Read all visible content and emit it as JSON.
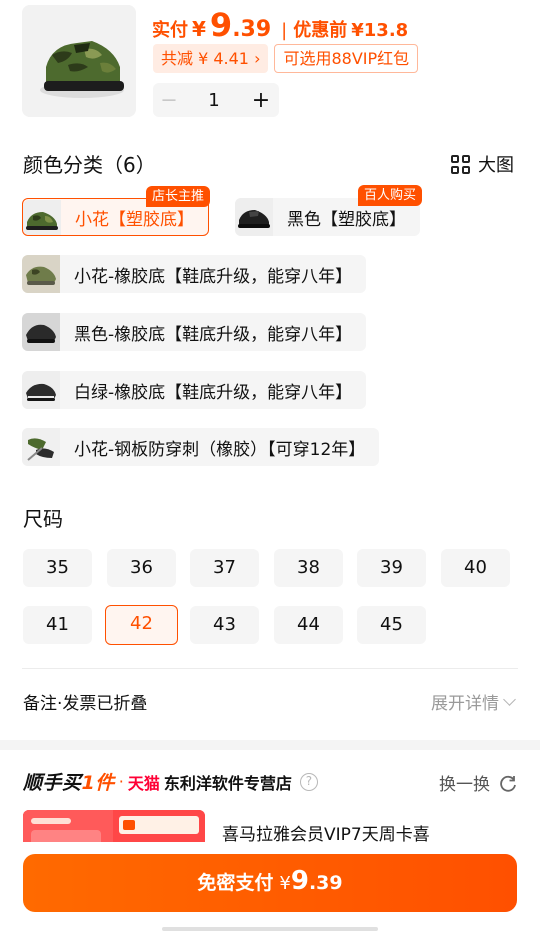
{
  "product": {
    "price_label": "实付",
    "currency": "¥",
    "price_int": "9",
    "price_dec": ".39",
    "orig_label": "优惠前",
    "orig_value": "13.8"
  },
  "promos": [
    {
      "text": "共减 ¥ 4.41 ›"
    },
    {
      "text": "可选用88VIP红包"
    }
  ],
  "stepper": {
    "minus": "－",
    "quantity": "1",
    "plus": "+"
  },
  "color_section": {
    "title": "颜色分类（6）",
    "big_view": "大图",
    "options": [
      {
        "label": "小花【塑胶底】",
        "badge": "店长主推",
        "selected": true
      },
      {
        "label": "黑色【塑胶底】",
        "badge": "百人购买",
        "selected": false
      },
      {
        "label": "小花-橡胶底【鞋底升级，能穿八年】",
        "badge": "",
        "selected": false
      },
      {
        "label": "黑色-橡胶底【鞋底升级，能穿八年】",
        "badge": "",
        "selected": false
      },
      {
        "label": "白绿-橡胶底【鞋底升级，能穿八年】",
        "badge": "",
        "selected": false
      },
      {
        "label": "小花-钢板防穿刺（橡胶）【可穿12年】",
        "badge": "",
        "selected": false
      }
    ]
  },
  "size_section": {
    "title": "尺码",
    "sizes": [
      "35",
      "36",
      "37",
      "38",
      "39",
      "40",
      "41",
      "42",
      "43",
      "44",
      "45"
    ],
    "selected": "42"
  },
  "notes": {
    "label": "备注·发票已折叠",
    "expand": "展开详情"
  },
  "shop": {
    "brand_prefix": "顺手买",
    "brand_highlight": "1件",
    "tmall": "天猫",
    "name": "东利洋软件专营店",
    "swap": "换一换",
    "rec_title": "喜马拉雅会员VIP7天周卡喜"
  },
  "pay": {
    "label": "免密支付",
    "currency": "¥",
    "int": "9",
    "dec": ".39"
  },
  "colors": {
    "accent": "#ff5000",
    "chip_bg": "#f5f5f5",
    "badge_bg": "#ff5000"
  }
}
